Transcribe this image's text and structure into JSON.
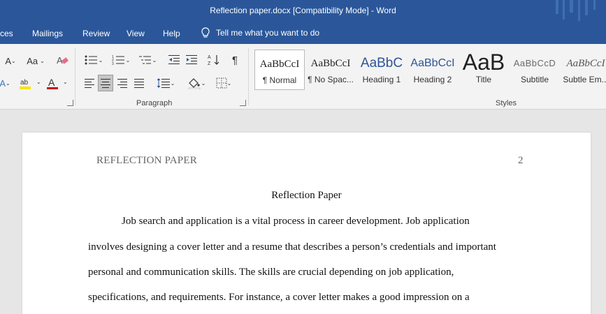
{
  "window": {
    "title": "Reflection paper.docx [Compatibility Mode]  -  Word"
  },
  "menu": {
    "tabs": [
      "ces",
      "Mailings",
      "Review",
      "View",
      "Help"
    ],
    "tell_me": "Tell me what you want to do"
  },
  "ribbon": {
    "font_group": {
      "change_case": "Aa",
      "font_grow": "A"
    },
    "paragraph_label": "Paragraph",
    "styles_label": "Styles",
    "styles": [
      {
        "sample": "AaBbCcI",
        "name": "¶ Normal"
      },
      {
        "sample": "AaBbCcI",
        "name": "¶ No Spac..."
      },
      {
        "sample": "AaBbC",
        "name": "Heading 1"
      },
      {
        "sample": "AaBbCcI",
        "name": "Heading 2"
      },
      {
        "sample": "AaB",
        "name": "Title"
      },
      {
        "sample": "AaBbCcD",
        "name": "Subtitle"
      },
      {
        "sample": "AaBbCcI",
        "name": "Subtle Em..."
      }
    ],
    "colors": {
      "highlight": "#f7e600",
      "font_color": "#d00000"
    }
  },
  "document": {
    "running_head": "REFLECTION PAPER",
    "page_number": "2",
    "title": "Reflection Paper",
    "lines": [
      "Job search and application is a vital process in career development. Job application",
      "involves designing a cover letter and a resume that describes a person’s credentials and important",
      "personal and communication skills. The skills are crucial depending on job application,",
      "specifications, and requirements. For instance, a cover letter makes a good impression on a"
    ]
  },
  "colors": {
    "accent": "#2b579a",
    "ribbon_bg": "#f3f3f3",
    "canvas_bg": "#e6e6e6"
  }
}
